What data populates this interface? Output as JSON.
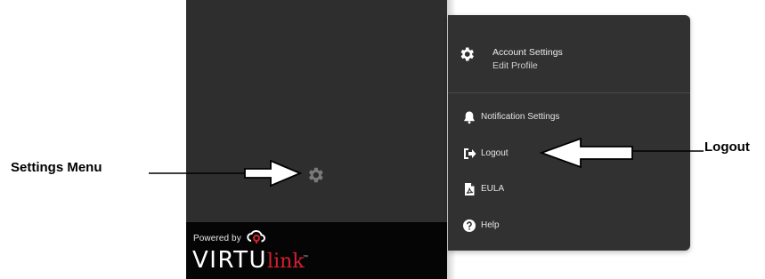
{
  "brand": {
    "powered_by": "Powered by",
    "name_part1": "VIRTU",
    "name_part2": "link",
    "trademark": "™",
    "accent_color": "#d5202f"
  },
  "sidebar": {
    "settings_icon": "gear-icon",
    "background": "#2e2e2e"
  },
  "menu": {
    "header": {
      "title": "Account Settings",
      "subtitle": "Edit Profile",
      "icon": "gear-icon"
    },
    "items": [
      {
        "label": "Notification Settings",
        "icon": "bell-icon"
      },
      {
        "label": "Logout",
        "icon": "sign-out-icon"
      },
      {
        "label": "EULA",
        "icon": "pdf-document-icon"
      },
      {
        "label": "Help",
        "icon": "question-circle-icon"
      }
    ]
  },
  "annotations": {
    "settings_menu": "Settings Menu",
    "logout": "Logout"
  }
}
